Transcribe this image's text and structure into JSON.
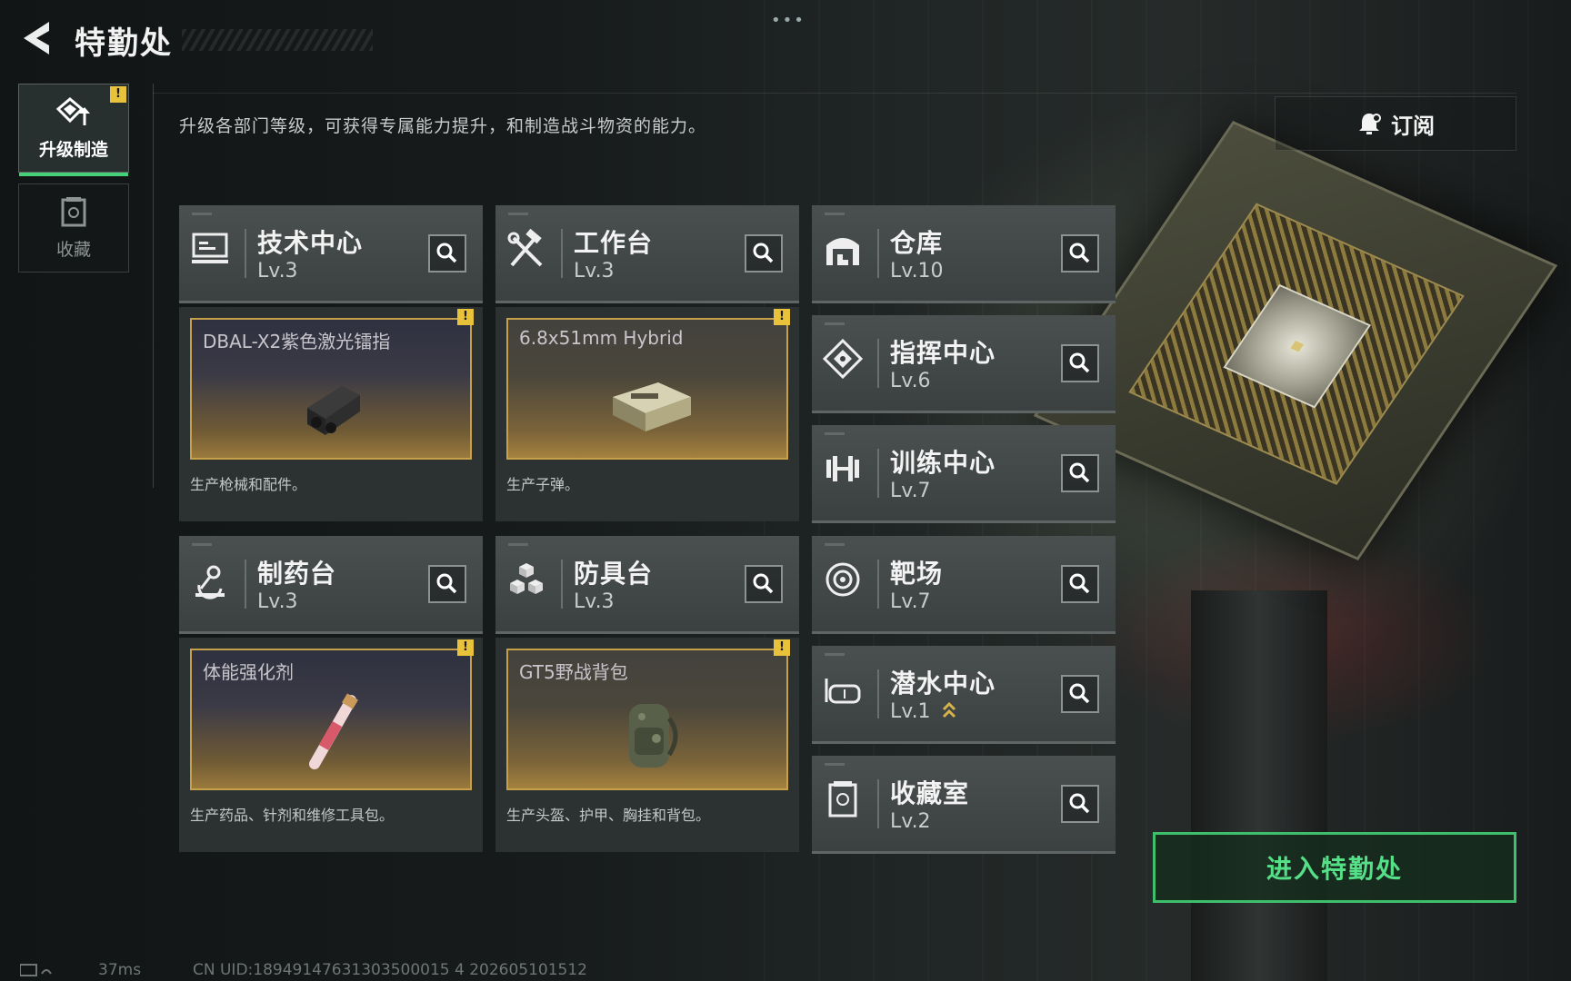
{
  "header": {
    "title": "特勤处",
    "menu_dots": "•••"
  },
  "sidebar": {
    "tabs": [
      {
        "label": "升级制造",
        "active": true,
        "alert": "!"
      },
      {
        "label": "收藏",
        "active": false
      }
    ]
  },
  "description": "升级各部门等级，可获得专属能力提升，和制造战斗物资的能力。",
  "subscribe": {
    "label": "订阅",
    "icon": "bell-icon"
  },
  "departments": [
    {
      "name": "技术中心",
      "level": "Lv.3",
      "icon": "computer-icon"
    },
    {
      "name": "工作台",
      "level": "Lv.3",
      "icon": "hammer-wrench-icon"
    },
    {
      "name": "仓库",
      "level": "Lv.10",
      "icon": "warehouse-icon"
    },
    {
      "name": "指挥中心",
      "level": "Lv.6",
      "icon": "command-icon"
    },
    {
      "name": "训练中心",
      "level": "Lv.7",
      "icon": "dumbbell-icon"
    },
    {
      "name": "制药台",
      "level": "Lv.3",
      "icon": "microscope-icon"
    },
    {
      "name": "防具台",
      "level": "Lv.3",
      "icon": "cubes-icon"
    },
    {
      "name": "靶场",
      "level": "Lv.7",
      "icon": "target-icon"
    },
    {
      "name": "潜水中心",
      "level": "Lv.1",
      "icon": "diving-mask-icon",
      "upgradable": true
    },
    {
      "name": "收藏室",
      "level": "Lv.2",
      "icon": "collection-icon"
    }
  ],
  "crafting": [
    {
      "item": "DBAL-X2紫色激光镭指",
      "desc": "生产枪械和配件。",
      "alert": "!"
    },
    {
      "item": "6.8x51mm Hybrid",
      "desc": "生产子弹。",
      "alert": "!"
    },
    {
      "item": "体能强化剂",
      "desc": "生产药品、针剂和维修工具包。",
      "alert": "!"
    },
    {
      "item": "GT5野战背包",
      "desc": "生产头盔、护甲、胸挂和背包。",
      "alert": "!"
    }
  ],
  "enter_button": "进入特勤处",
  "footer": {
    "ping": "37ms",
    "uid": "CN UID:18949147631303500015 4 202605101512"
  },
  "colors": {
    "accent_green": "#45d07a",
    "alert_yellow": "#e8c23a",
    "craft_border": "#c7a14a"
  }
}
